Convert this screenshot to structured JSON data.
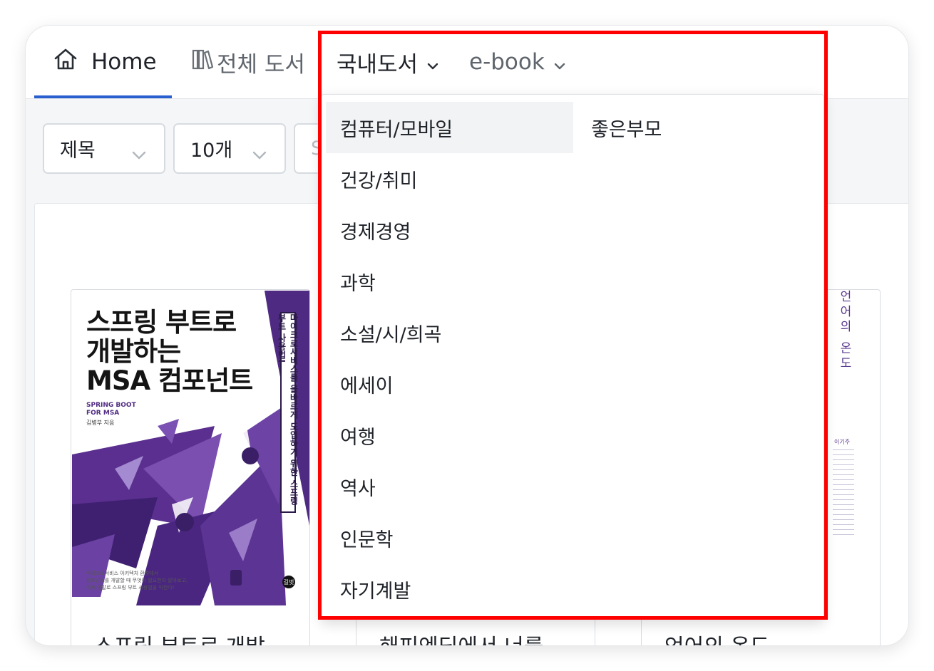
{
  "nav": {
    "home_label": "Home",
    "all_books_label": "전체 도서",
    "domestic_label": "국내도서",
    "ebook_label": "e-book"
  },
  "filters": {
    "field_value": "제목",
    "count_value": "10개",
    "third_value": "S"
  },
  "dropdown": {
    "column1": [
      "컴퓨터/모바일",
      "건강/취미",
      "경제경영",
      "과학",
      "소설/시/희곡",
      "에세이",
      "여행",
      "역사",
      "인문학",
      "자기계발"
    ],
    "column2": [
      "좋은부모"
    ],
    "hovered_item": "컴퓨터/모바일"
  },
  "books": [
    {
      "title": "스프링 부트로 개발",
      "cover": {
        "title_lines": [
          "스프링 부트로",
          "개발하는",
          "MSA 컴포넌트"
        ],
        "english": [
          "SPRING BOOT",
          "FOR MSA"
        ],
        "author": "김병부 지음",
        "vertical": "마이크로서비스를 올바르게 도입하기 위한 스프링 부트 사용법!",
        "desc": [
          "마이크로서비스 아키텍처 환경에서",
          "컴포넌트를 개발할 때 무엇이 필요한지 알아보고,",
          "이제 정말로 스프링 부트 사용법을 익힌다!"
        ],
        "publisher_mark": "길벗"
      }
    },
    {
      "title": "해피엔딩에서 너를"
    },
    {
      "title": "언어의 온도",
      "cover": {
        "vertical": "언어의 온도",
        "author": "이기주"
      }
    }
  ],
  "colors": {
    "accent": "#2a5fd0",
    "highlight": "#ff0000",
    "cover_purple": "#4f2a82"
  }
}
